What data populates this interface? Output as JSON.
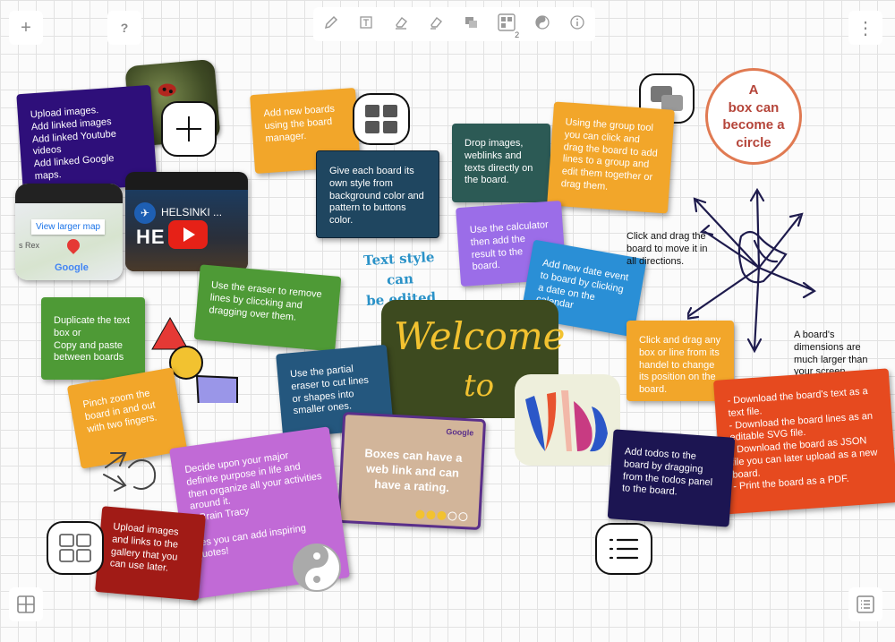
{
  "toolbar": {
    "add_label": "+",
    "help_label": "?",
    "more_label": "⋮",
    "group_count": "2"
  },
  "cards": {
    "upload_images": "Upload images.\nAdd linked images\nAdd linked Youtube videos\nAdd linked Google maps.",
    "add_boards": "Add new boards using the board manager.",
    "board_style": "Give each board its  own style from background color and pattern to buttons color.",
    "drop_images": "Drop images, weblinks and texts directly on the board.",
    "group_tool": "Using the group tool you can click and drag the board to add lines to a group and edit them together or drag them.",
    "calculator": "Use the calculator then add the result to the board.",
    "date_event": "Add new date event to board by clicking a date on the calendar",
    "eraser": "Use the eraser to remove lines by cliccking and dragging over them.",
    "duplicate": "Duplicate the text box or\nCopy and paste between boards",
    "partial_eraser": "Use the partial eraser to cut lines or shapes into smaller ones.",
    "pinch_zoom": "Pinch zoom the board in and out with two fingers.",
    "click_drag_box": "Click and drag any box or line from its handel to change its position on the board.",
    "download": "- Download the board's text as a text file.\n- Download the board lines as an editable SVG file.\n- Download the board as JSON file you can later upload as a new board.\n- Print the board as a PDF.",
    "todos": "Add todos to the board by dragging from the todos panel to the board.",
    "quote": "Decide upon your major definite purpose in life and then organize all your activities around it.\n– Brain Tracy\n\nYes you can add inspiring quotes!",
    "gallery": "Upload images and links to the gallery that you can use later.",
    "weblink": "Boxes can have a web link and can have a rating.",
    "weblink_source": "Google"
  },
  "rating": {
    "value": 3,
    "max": 5
  },
  "text_style": "Text style can\nbe edited",
  "circle_text": "A\nbox can\nbecome a\ncircle",
  "welcome_line1": "Welcome",
  "welcome_line2": "to",
  "notes": {
    "drag_board": "Click and drag the board to move it in all directions.",
    "dimensions": "A board's dimensions are much larger than your screen."
  },
  "map": {
    "button": "View larger map",
    "place": "s Rex",
    "logo": "Google"
  },
  "video": {
    "title": "HELSINKI ...",
    "overlay": "HE   KI"
  },
  "colors": {
    "purple_dark": "#2e0f7a",
    "orange": "#f2a62a",
    "navy_teal": "#1f4660",
    "dark_teal": "#2c5a55",
    "lavender": "#9b6de8",
    "blue": "#2a8fd6",
    "olive": "#6b9a2e",
    "green": "#4e9a36",
    "slate_blue": "#24577e",
    "red_orange": "#e64a1f",
    "dark_navy": "#1c1552",
    "magenta": "#c16ad6",
    "dark_red": "#a11b16",
    "welcome_bg": "#3d4a1f",
    "welcome_text": "#f2c230",
    "circle_border": "#e07a52",
    "circle_text": "#b5453a",
    "text_style": "#2a92c8"
  }
}
